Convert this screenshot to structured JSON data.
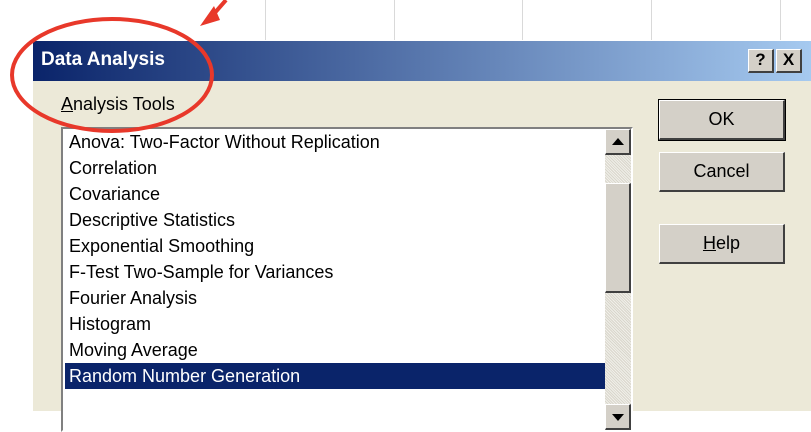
{
  "dialog": {
    "title": "Data Analysis",
    "help_button": "?",
    "close_button": "X"
  },
  "analysis_tools": {
    "label_underlined": "A",
    "label_rest": "nalysis Tools",
    "items": [
      "Anova: Two-Factor Without Replication",
      "Correlation",
      "Covariance",
      "Descriptive Statistics",
      "Exponential Smoothing",
      "F-Test Two-Sample for Variances",
      "Fourier Analysis",
      "Histogram",
      "Moving Average",
      "Random Number Generation"
    ],
    "selected_index": 9
  },
  "buttons": {
    "ok": "OK",
    "cancel": "Cancel",
    "help_underlined": "H",
    "help_rest": "elp"
  },
  "colors": {
    "title_gradient_start": "#0a246a",
    "selection": "#0a246a",
    "annotation": "#e8382a"
  }
}
